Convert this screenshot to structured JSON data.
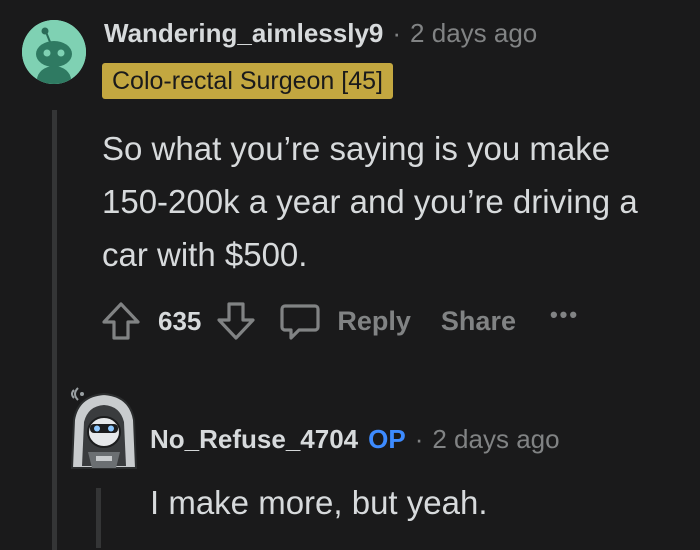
{
  "comment": {
    "username": "Wandering_aimlessly9",
    "separator": "·",
    "timestamp": "2 days ago",
    "flair": "Colo-rectal Surgeon [45]",
    "body": "So what you’re saying is you make 150-200k a year and you’re driving a car with $500.",
    "avatar_icon": "reddit-snoo-avatar-icon",
    "actions": {
      "vote_count": "635",
      "upvote_icon": "arrow-up-icon",
      "downvote_icon": "arrow-down-icon",
      "reply_icon": "speech-bubble-icon",
      "reply_label": "Reply",
      "share_label": "Share",
      "more_label": "•••"
    }
  },
  "reply": {
    "username": "No_Refuse_4704",
    "op_badge": "OP",
    "separator": "·",
    "timestamp": "2 days ago",
    "body": "I make more, but yeah.",
    "avatar_icon": "hooded-figure-avatar-icon"
  },
  "colors": {
    "background": "#1a1a1b",
    "text": "#d7dadc",
    "muted": "#818384",
    "flair_bg": "#c3a740",
    "op_blue": "#3d8bff",
    "avatar_bg": "#7fd1b3"
  }
}
